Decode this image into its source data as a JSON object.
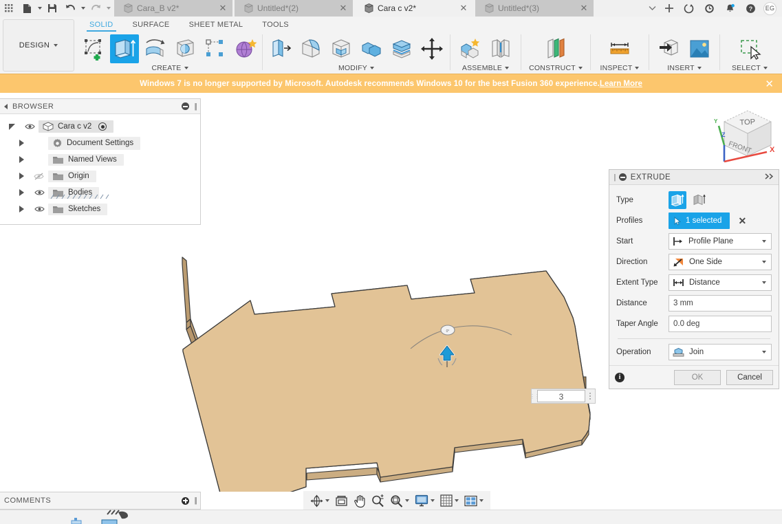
{
  "titlebar": {
    "tabs": [
      {
        "name": "Cara_B v2*",
        "state": "inactive",
        "close": "✕"
      },
      {
        "name": "Untitled*(2)",
        "state": "inactive",
        "close": "✕"
      },
      {
        "name": "Cara c v2*",
        "state": "active",
        "close": "✕"
      },
      {
        "name": "Untitled*(3)",
        "state": "inactive",
        "close": "✕"
      }
    ],
    "icons": {
      "grid": "apps-grid-icon",
      "file": "new-file-icon",
      "save": "save-icon",
      "undo": "undo-icon",
      "redo": "redo-icon",
      "tab_overflow": "chevron-down-icon",
      "new_tab": "plus-icon",
      "refresh": "job-status-icon",
      "history": "recent-icon",
      "notifications": "bell-icon",
      "help": "help-icon"
    },
    "avatar_initials": "EG"
  },
  "ribbon": {
    "design_label": "DESIGN",
    "workspace_tabs": [
      {
        "label": "SOLID",
        "active": true
      },
      {
        "label": "SURFACE",
        "active": false
      },
      {
        "label": "SHEET METAL",
        "active": false
      },
      {
        "label": "TOOLS",
        "active": false
      }
    ],
    "groups": [
      {
        "label": "CREATE",
        "items": [
          {
            "name": "create-sketch-icon",
            "selected": false
          },
          {
            "name": "extrude-icon",
            "selected": true
          },
          {
            "name": "revolve-icon",
            "selected": false
          },
          {
            "name": "sweep-icon",
            "selected": false
          },
          {
            "name": "pattern-icon",
            "selected": false
          },
          {
            "name": "create-form-icon",
            "selected": false
          }
        ]
      },
      {
        "label": "MODIFY",
        "items": [
          {
            "name": "press-pull-icon",
            "selected": false
          },
          {
            "name": "fillet-icon",
            "selected": false
          },
          {
            "name": "shell-icon",
            "selected": false
          },
          {
            "name": "combine-icon",
            "selected": false
          },
          {
            "name": "split-face-icon",
            "selected": false
          },
          {
            "name": "move-copy-icon",
            "selected": false
          }
        ]
      },
      {
        "label": "ASSEMBLE",
        "items": [
          {
            "name": "new-component-icon",
            "selected": false
          },
          {
            "name": "joint-icon",
            "selected": false
          }
        ]
      },
      {
        "label": "CONSTRUCT",
        "items": [
          {
            "name": "offset-plane-icon",
            "selected": false
          }
        ]
      },
      {
        "label": "INSPECT",
        "items": [
          {
            "name": "measure-icon",
            "selected": false
          }
        ]
      },
      {
        "label": "INSERT",
        "items": [
          {
            "name": "insert-derive-icon",
            "selected": false
          },
          {
            "name": "canvas-image-icon",
            "selected": false
          }
        ]
      },
      {
        "label": "SELECT",
        "items": [
          {
            "name": "select-window-icon",
            "selected": false
          }
        ]
      }
    ]
  },
  "warning": {
    "text": "Windows 7 is no longer supported by Microsoft. Autodesk recommends Windows 10 for the best Fusion 360 experience. ",
    "link": "Learn More",
    "close": "✕",
    "background": "#fcc66d"
  },
  "browser": {
    "title": "BROWSER",
    "collapse_icon": "minus-circle-icon",
    "grip_icon": "panel-grip-icon",
    "items": [
      {
        "label": "Cara c v2",
        "level": 0,
        "expander": "open",
        "eye": true,
        "icon": "component-icon",
        "radio": true
      },
      {
        "label": "Document Settings",
        "level": 1,
        "expander": "closed",
        "eye": false,
        "icon": "gear-icon",
        "radio": false
      },
      {
        "label": "Named Views",
        "level": 1,
        "expander": "closed",
        "eye": false,
        "icon": "folder-icon",
        "radio": false
      },
      {
        "label": "Origin",
        "level": 1,
        "expander": "closed",
        "eye": "hidden",
        "icon": "folder-icon",
        "radio": false
      },
      {
        "label": "Bodies",
        "level": 1,
        "expander": "closed",
        "eye": true,
        "icon": "folder-icon",
        "radio": false
      },
      {
        "label": "Sketches",
        "level": 1,
        "expander": "closed",
        "eye": true,
        "icon": "folder-icon",
        "radio": false
      }
    ]
  },
  "canvas": {
    "model_face_color": "#e2c396",
    "model_edge_color": "#3a3a3a",
    "model_side_color": "#c5a478",
    "background": "#ffffff",
    "distance_input_value": "3",
    "manipulator_arrow_color": "#1d9bd7",
    "viewcube": {
      "top_label": "TOP",
      "front_label": "FRONT",
      "axis_x": "X",
      "axis_y": "Y",
      "axis_z": "Z",
      "x_color": "#e8493f",
      "y_color": "#4caf50",
      "z_color": "#3b63c4"
    }
  },
  "extrude": {
    "title": "EXTRUDE",
    "collapse_icon": "minus-circle-icon",
    "expand_icon": "double-chevron-right-icon",
    "fields": {
      "type_label": "Type",
      "type_options": [
        "extrude-profile-icon",
        "extrude-surface-icon"
      ],
      "type_selected_index": 0,
      "profiles_label": "Profiles",
      "profiles_value": "1 selected",
      "profiles_clear": "✕",
      "start_label": "Start",
      "start_value": "Profile Plane",
      "direction_label": "Direction",
      "direction_value": "One Side",
      "extent_type_label": "Extent Type",
      "extent_type_value": "Distance",
      "distance_label": "Distance",
      "distance_value": "3 mm",
      "taper_angle_label": "Taper Angle",
      "taper_angle_value": "0.0 deg",
      "operation_label": "Operation",
      "operation_value": "Join"
    },
    "footer": {
      "info_icon": "info-icon",
      "ok_label": "OK",
      "cancel_label": "Cancel"
    },
    "accent_color": "#1aa3e8"
  },
  "comments": {
    "title": "COMMENTS",
    "add_icon": "plus-circle-icon",
    "grip_icon": "panel-grip-icon"
  },
  "navbar": {
    "items": [
      {
        "name": "orbit-icon",
        "caret": true
      },
      {
        "name": "look-at-icon",
        "caret": false
      },
      {
        "name": "pan-icon",
        "caret": false
      },
      {
        "name": "zoom-icon",
        "caret": false
      },
      {
        "name": "fit-icon",
        "caret": true
      },
      {
        "name": "display-settings-icon",
        "caret": true
      },
      {
        "name": "grid-snaps-icon",
        "caret": true
      },
      {
        "name": "viewports-icon",
        "caret": true
      }
    ]
  }
}
